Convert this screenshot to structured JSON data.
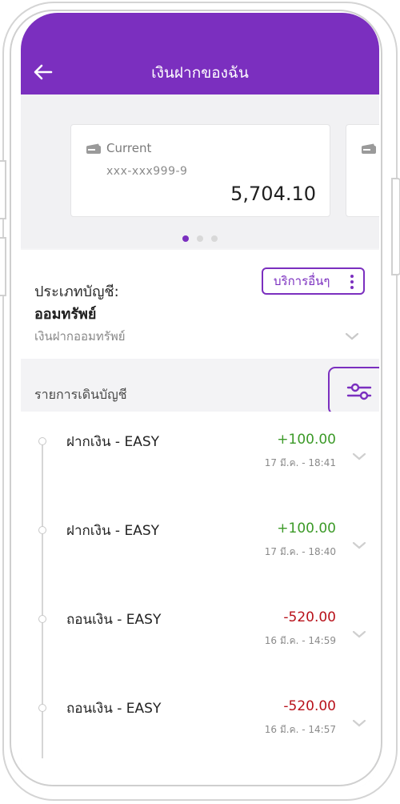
{
  "header": {
    "title": "เงินฝากของฉัน"
  },
  "carousel": {
    "cards": [
      {
        "type": "Current",
        "account_number": "xxx-xxx999-9",
        "balance": "5,704.10"
      }
    ],
    "page_count": 3,
    "active_index": 0
  },
  "account": {
    "label": "ประเภทบัญชี:",
    "type": "ออมทรัพย์",
    "subtype": "เงินฝากออมทรัพย์",
    "services_label": "บริการอื่นๆ"
  },
  "transactions": {
    "title": "รายการเดินบัญชี",
    "items": [
      {
        "name": "ฝากเงิน - EASY",
        "amount": "+100.00",
        "date": "17 มี.ค. - 18:41",
        "direction": "credit"
      },
      {
        "name": "ฝากเงิน - EASY",
        "amount": "+100.00",
        "date": "17 มี.ค. - 18:40",
        "direction": "credit"
      },
      {
        "name": "ถอนเงิน - EASY",
        "amount": "-520.00",
        "date": "16 มี.ค. - 14:59",
        "direction": "debit"
      },
      {
        "name": "ถอนเงิน - EASY",
        "amount": "-520.00",
        "date": "16 มี.ค. - 14:57",
        "direction": "debit"
      }
    ]
  },
  "colors": {
    "brand": "#7b2fbf",
    "credit": "#3c9a28",
    "debit": "#b8121b"
  },
  "icons": {
    "back": "arrow-left-icon",
    "card": "card-icon",
    "more": "kebab-icon",
    "expand": "chevron-down-icon",
    "filter": "sliders-icon"
  }
}
